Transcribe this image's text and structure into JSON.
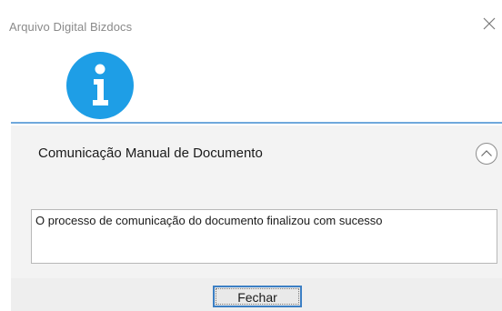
{
  "window": {
    "title": "Arquivo Digital Bizdocs",
    "close_icon": "close-icon"
  },
  "dialog": {
    "icon": "info-icon",
    "icon_color": "#1e9ee6",
    "accent_line_color": "#6fa8dc",
    "heading": "Comunicação Manual de Documento",
    "collapse_icon": "chevron-up-icon",
    "message": "O processo de comunicação do documento finalizou com sucesso"
  },
  "footer": {
    "close_button_label": "Fechar"
  }
}
